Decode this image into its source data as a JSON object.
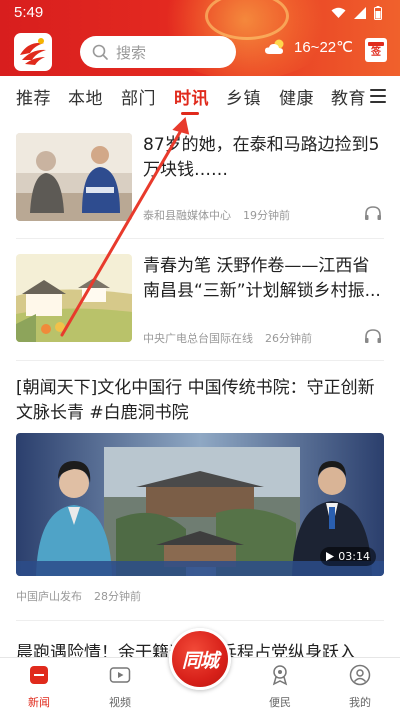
{
  "status_bar": {
    "time": "5:49"
  },
  "header": {
    "search_placeholder": "搜索",
    "weather": {
      "temp": "16~22℃",
      "icon": "cloud-sun-icon"
    },
    "sign_label": "签"
  },
  "tabs": [
    {
      "label": "推荐"
    },
    {
      "label": "本地"
    },
    {
      "label": "部门"
    },
    {
      "label": "时讯",
      "active": true
    },
    {
      "label": "乡镇"
    },
    {
      "label": "健康"
    },
    {
      "label": "教育"
    }
  ],
  "feed": [
    {
      "title": "87岁的她，在泰和马路边捡到5万块钱……",
      "source": "泰和县融媒体中心",
      "time": "19分钟前"
    },
    {
      "title": "青春为笔 沃野作卷——江西省南昌县“三新”计划解锁乡村振...",
      "source": "中央广电总台国际在线",
      "time": "26分钟前"
    },
    {
      "title": "[朝闻天下]文化中国行 中国传统书院：守正创新 文脉长青 #白鹿洞书院",
      "source": "中国庐山发布",
      "time": "28分钟前",
      "duration": "03:14"
    },
    {
      "title": "晨跑遇险情！余干籍退伍老兵程占党纵身跃入"
    }
  ],
  "bottom_nav": [
    {
      "label": "新闻",
      "icon": "news-icon",
      "active": true
    },
    {
      "label": "视频",
      "icon": "video-icon"
    },
    {
      "label": "便民",
      "icon": "service-icon"
    },
    {
      "label": "我的",
      "icon": "profile-icon"
    }
  ],
  "center_button": {
    "label": "同城"
  },
  "colors": {
    "brand_red": "#e02a1c",
    "header_start": "#d81e1e",
    "header_end": "#f0612c"
  }
}
